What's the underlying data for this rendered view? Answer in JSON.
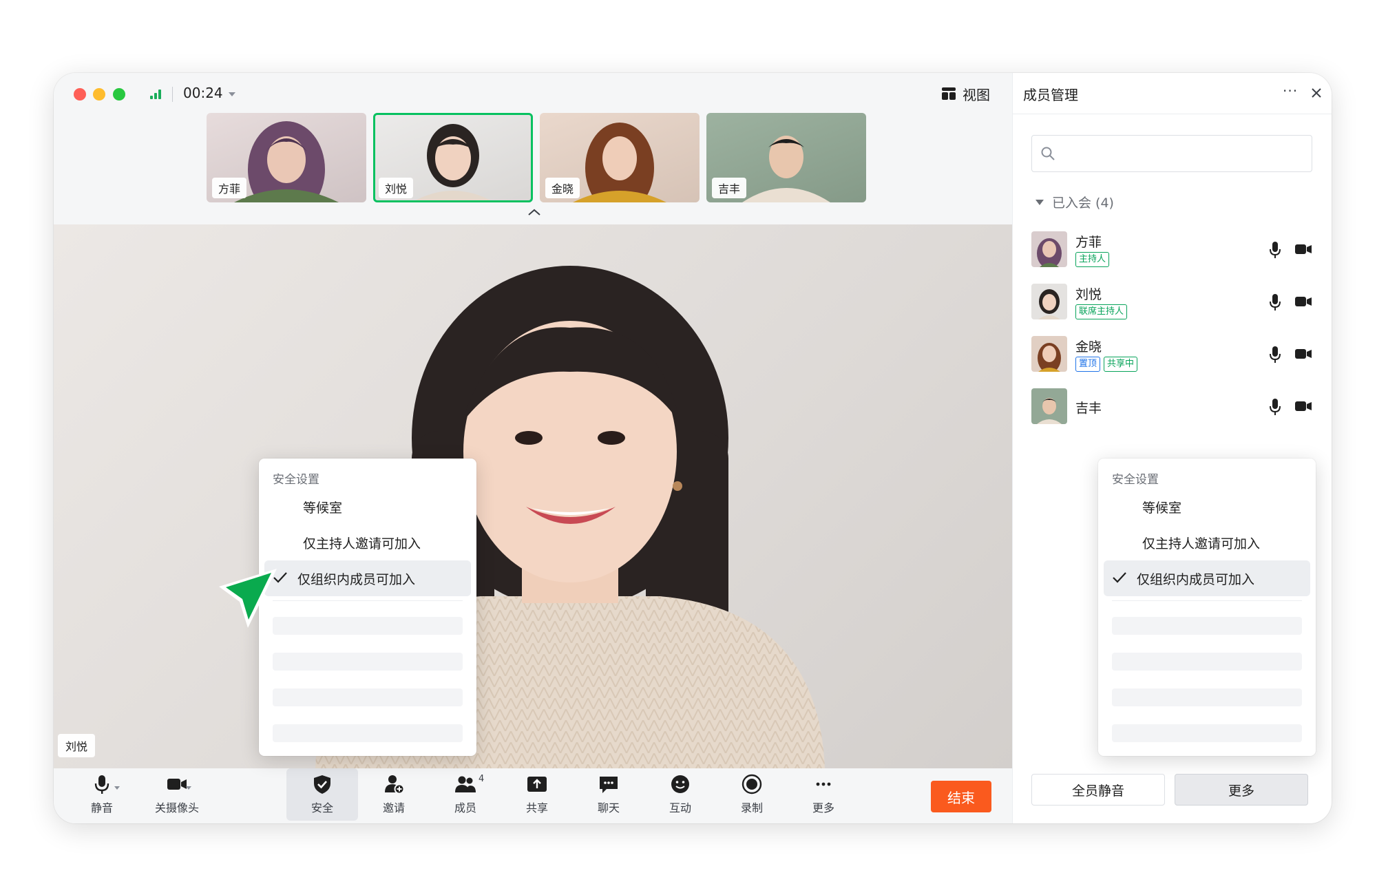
{
  "meeting": {
    "timer": "00:24",
    "view_label": "视图"
  },
  "thumbnails": [
    {
      "name": "方菲",
      "active": false
    },
    {
      "name": "刘悦",
      "active": true
    },
    {
      "name": "金晓",
      "active": false
    },
    {
      "name": "吉丰",
      "active": false
    }
  ],
  "stage": {
    "speaker_name": "刘悦"
  },
  "toolbar": {
    "mute": "静音",
    "camera": "关摄像头",
    "security": "安全",
    "invite": "邀请",
    "members": "成员",
    "members_count": "4",
    "share": "共享",
    "chat": "聊天",
    "interact": "互动",
    "record": "录制",
    "more": "更多",
    "end": "结束"
  },
  "security_menu": {
    "title": "安全设置",
    "items": [
      {
        "label": "等候室",
        "checked": false
      },
      {
        "label": "仅主持人邀请可加入",
        "checked": false
      },
      {
        "label": "仅组织内成员可加入",
        "checked": true
      }
    ]
  },
  "side_panel": {
    "title": "成员管理",
    "more": "···",
    "group_label": "已入会 (4)",
    "members": [
      {
        "name": "方菲",
        "tags": [
          {
            "text": "主持人",
            "color": "green"
          }
        ]
      },
      {
        "name": "刘悦",
        "tags": [
          {
            "text": "联席主持人",
            "color": "green"
          }
        ]
      },
      {
        "name": "金晓",
        "tags": [
          {
            "text": "置顶",
            "color": "blue"
          },
          {
            "text": "共享中",
            "color": "green"
          }
        ]
      },
      {
        "name": "吉丰",
        "tags": []
      }
    ],
    "mute_all": "全员静音",
    "more_button": "更多"
  },
  "colors": {
    "accent_green": "#07c160",
    "end_orange": "#fa5a1e",
    "tag_blue": "#1f73e8"
  }
}
